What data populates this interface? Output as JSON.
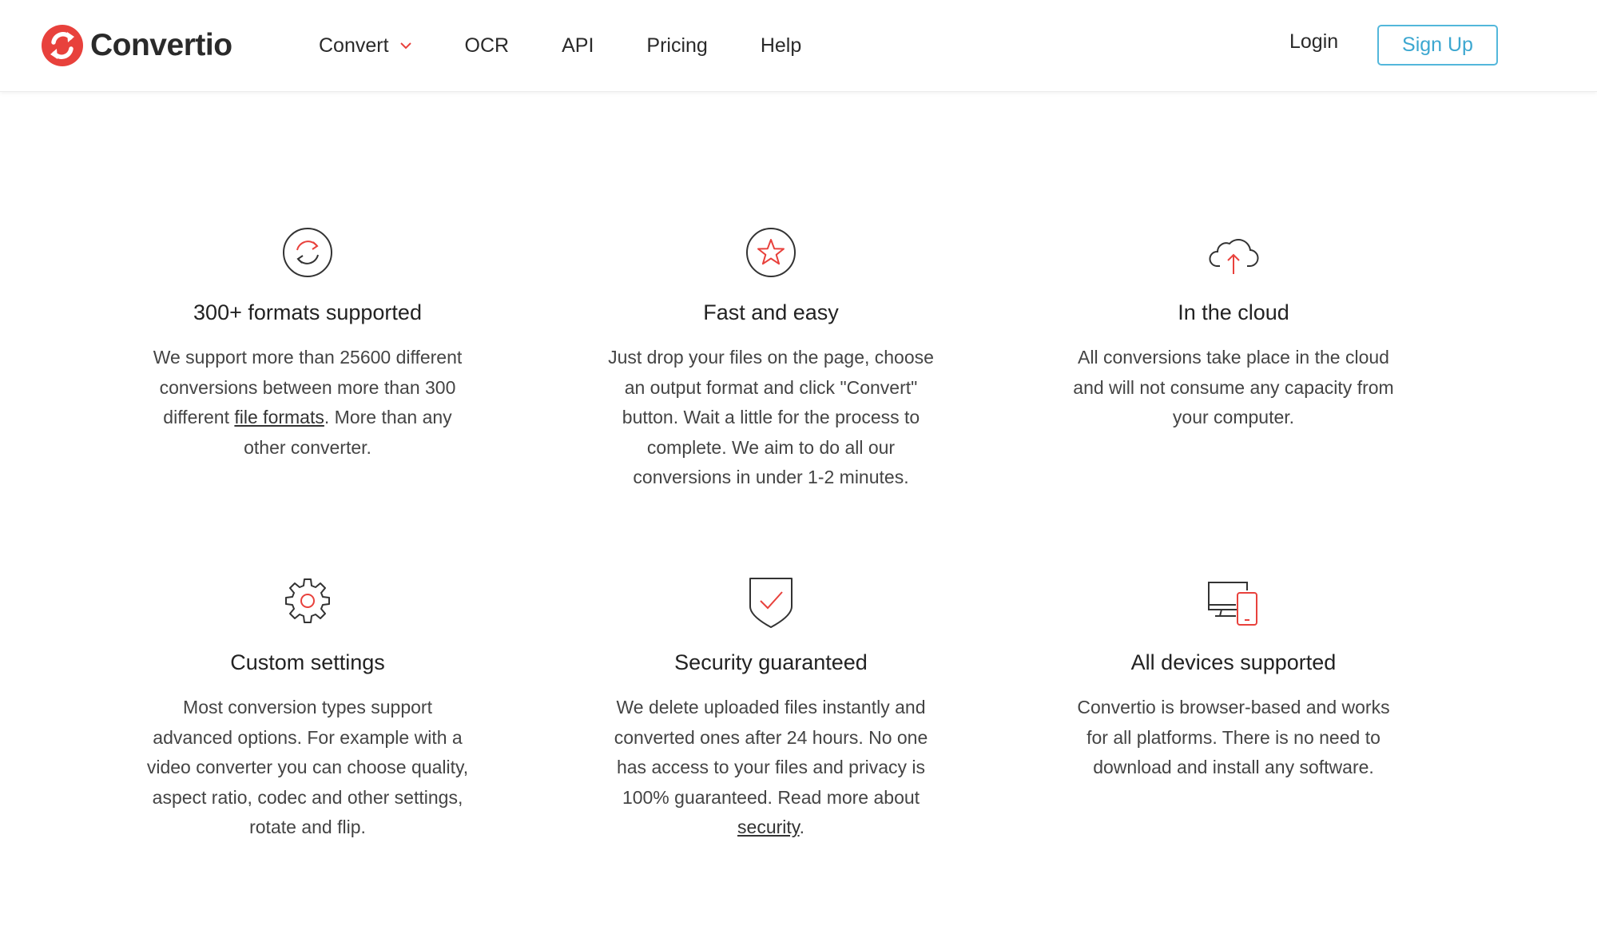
{
  "brand": {
    "name": "Convertio",
    "accent": "#e8413c",
    "link_color": "#3ca7d0"
  },
  "nav": {
    "items": [
      "Convert",
      "OCR",
      "API",
      "Pricing",
      "Help"
    ],
    "convert_has_dropdown": true
  },
  "auth": {
    "login": "Login",
    "signup": "Sign Up"
  },
  "features": [
    {
      "icon": "refresh-icon",
      "title": "300+ formats supported",
      "text_before": "We support more than 25600 different conversions between more than 300 different ",
      "link": "file formats",
      "text_after": ". More than any other converter."
    },
    {
      "icon": "star-icon",
      "title": "Fast and easy",
      "text": "Just drop your files on the page, choose an output format and click \"Convert\" button. Wait a little for the process to complete. We aim to do all our conversions in under 1-2 minutes."
    },
    {
      "icon": "cloud-upload-icon",
      "title": "In the cloud",
      "text": "All conversions take place in the cloud and will not consume any capacity from your computer."
    },
    {
      "icon": "gear-icon",
      "title": "Custom settings",
      "text": "Most conversion types support advanced options. For example with a video converter you can choose quality, aspect ratio, codec and other settings, rotate and flip."
    },
    {
      "icon": "shield-check-icon",
      "title": "Security guaranteed",
      "text_before": "We delete uploaded files instantly and converted ones after 24 hours. No one has access to your files and privacy is 100% guaranteed. Read more about ",
      "link": "security",
      "text_after": "."
    },
    {
      "icon": "devices-icon",
      "title": "All devices supported",
      "text": "Convertio is browser-based and works for all platforms. There is no need to download and install any software."
    }
  ]
}
